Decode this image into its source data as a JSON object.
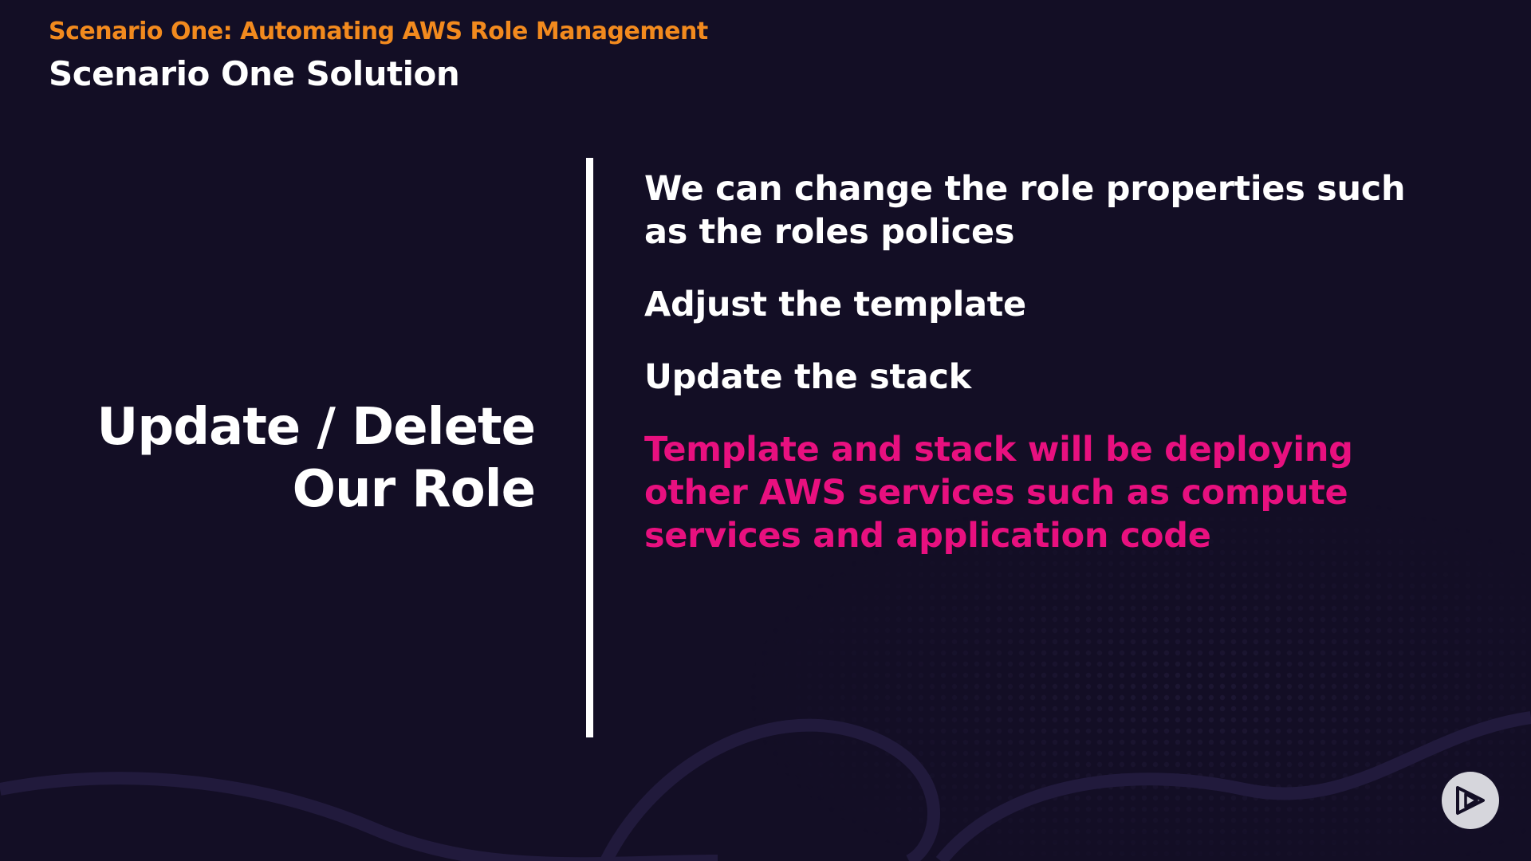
{
  "header": {
    "eyebrow": "Scenario One: Automating AWS Role Management",
    "title": "Scenario One Solution"
  },
  "section_heading": {
    "line1": "Update / Delete",
    "line2": "Our Role"
  },
  "bullets": [
    {
      "text": "We can change the role properties such as the roles polices"
    },
    {
      "text": "Adjust the template"
    },
    {
      "text": "Update the stack"
    },
    {
      "text": "Template and stack will be deploying other AWS services such as compute services and application code"
    }
  ],
  "controls": {
    "play_icon": "play-icon"
  },
  "colors": {
    "background": "#130e25",
    "accent_orange": "#f28a1e",
    "accent_pink": "#e8107f",
    "text": "#ffffff"
  }
}
